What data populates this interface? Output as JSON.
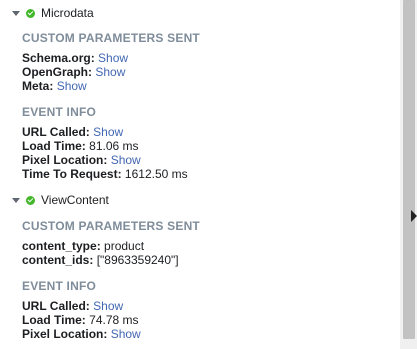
{
  "events": [
    {
      "name": "Microdata",
      "custom_title": "CUSTOM PARAMETERS SENT",
      "params": [
        {
          "key": "Schema.org",
          "link": "Show"
        },
        {
          "key": "OpenGraph",
          "link": "Show"
        },
        {
          "key": "Meta",
          "link": "Show"
        }
      ],
      "info_title": "EVENT INFO",
      "info": [
        {
          "key": "URL Called",
          "link": "Show"
        },
        {
          "key": "Load Time",
          "value": "81.06 ms"
        },
        {
          "key": "Pixel Location",
          "link": "Show"
        },
        {
          "key": "Time To Request",
          "value": "1612.50 ms"
        }
      ]
    },
    {
      "name": "ViewContent",
      "custom_title": "CUSTOM PARAMETERS SENT",
      "params": [
        {
          "key": "content_type",
          "value": "product"
        },
        {
          "key": "content_ids",
          "value": "[\"8963359240\"]"
        }
      ],
      "info_title": "EVENT INFO",
      "info": [
        {
          "key": "URL Called",
          "link": "Show"
        },
        {
          "key": "Load Time",
          "value": "74.78 ms"
        },
        {
          "key": "Pixel Location",
          "link": "Show"
        }
      ]
    }
  ],
  "colors": {
    "section_title": "#7f8c9a",
    "link": "#4267b2",
    "check": "#42b72a"
  }
}
